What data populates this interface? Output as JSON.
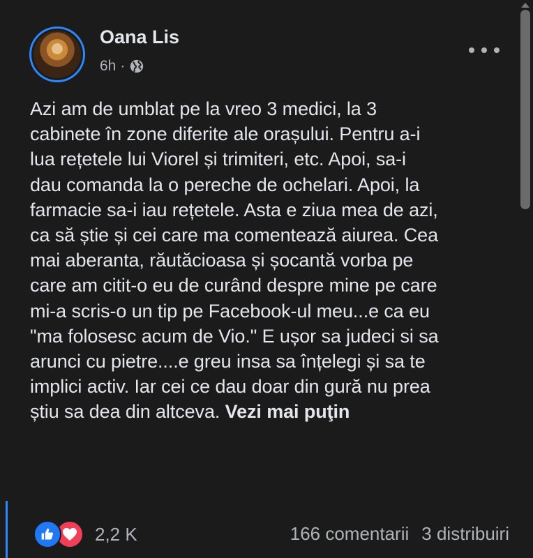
{
  "post": {
    "author": "Oana Lis",
    "time": "6h",
    "separator": "·",
    "privacy_icon": "globe-icon",
    "text": "Azi am de umblat pe la vreo 3 medici, la 3\ncabinete în zone diferite ale orașului. Pentru a-i\nlua rețetele lui Viorel și trimiteri, etc. Apoi, sa-i\ndau comanda la o pereche de ochelari. Apoi, la\nfarmacie sa-i iau rețetele. Asta e ziua mea de azi,\nca să știe și cei care ma comentează aiurea. Cea\nmai aberanta, răutăcioasa și șocantă vorba pe\ncare am citit-o eu de curând despre mine pe care\nmi-a scris-o un tip pe Facebook-ul meu...e ca eu\n\"ma folosesc acum de Vio.\" E ușor sa judeci si sa\narunci cu pietre....e greu insa sa înțelegi și sa te\nimplici activ. Iar cei ce dau doar din gură nu prea\nștiu sa dea din altceva. ",
    "see_less": "Vezi mai puţin"
  },
  "footer": {
    "reaction_icons": [
      "like-icon",
      "love-icon"
    ],
    "reaction_count": "2,2 K",
    "comments": "166 comentarii",
    "shares": "3 distribuiri"
  },
  "colors": {
    "background": "#1b1b1c",
    "accent": "#2d88ff",
    "like": "#2078f4",
    "love": "#f33e58",
    "secondary_text": "#b0b3b8"
  }
}
